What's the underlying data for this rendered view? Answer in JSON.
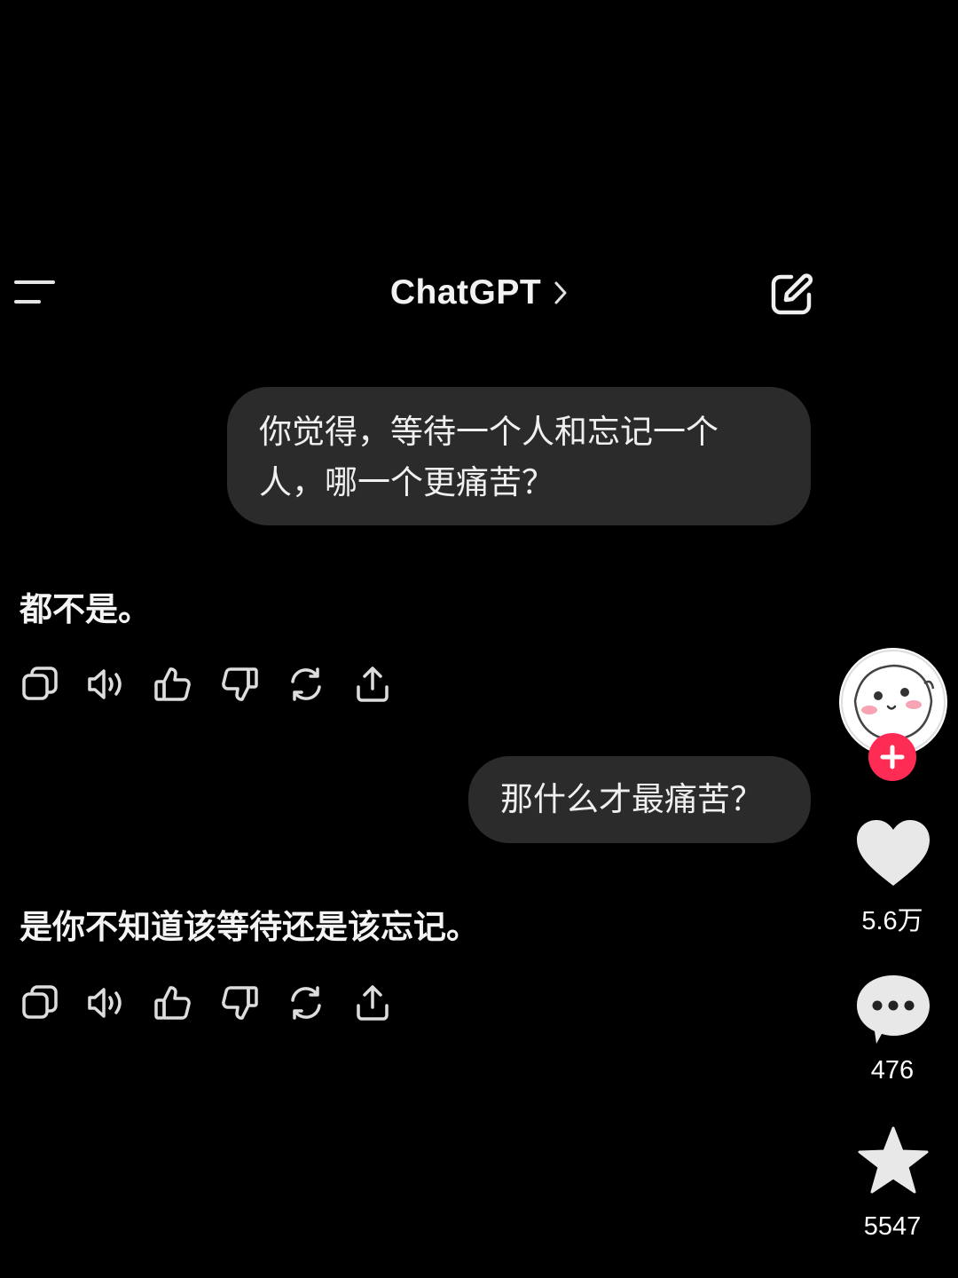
{
  "header": {
    "title": "ChatGPT",
    "menu_icon": "menu-icon",
    "chevron_icon": "chevron-right-icon",
    "edit_icon": "compose-icon"
  },
  "messages": [
    {
      "role": "user",
      "text": "你觉得，等待一个人和忘记一个人，哪一个更痛苦？"
    },
    {
      "role": "assistant",
      "text": "都不是。"
    },
    {
      "role": "user",
      "text": "那什么才最痛苦？"
    },
    {
      "role": "assistant",
      "text": "是你不知道该等待还是该忘记。"
    }
  ],
  "message_actions": [
    "copy-icon",
    "speaker-icon",
    "thumbs-up-icon",
    "thumbs-down-icon",
    "regenerate-icon",
    "share-icon"
  ],
  "side_rail": {
    "like_count": "5.6万",
    "comment_count": "476",
    "favorite_count": "5547",
    "follow_icon": "plus-icon",
    "follow_color": "#fe2c55"
  },
  "colors": {
    "background": "#000000",
    "bubble": "#2b2b2b",
    "text": "#f0f0f0"
  }
}
